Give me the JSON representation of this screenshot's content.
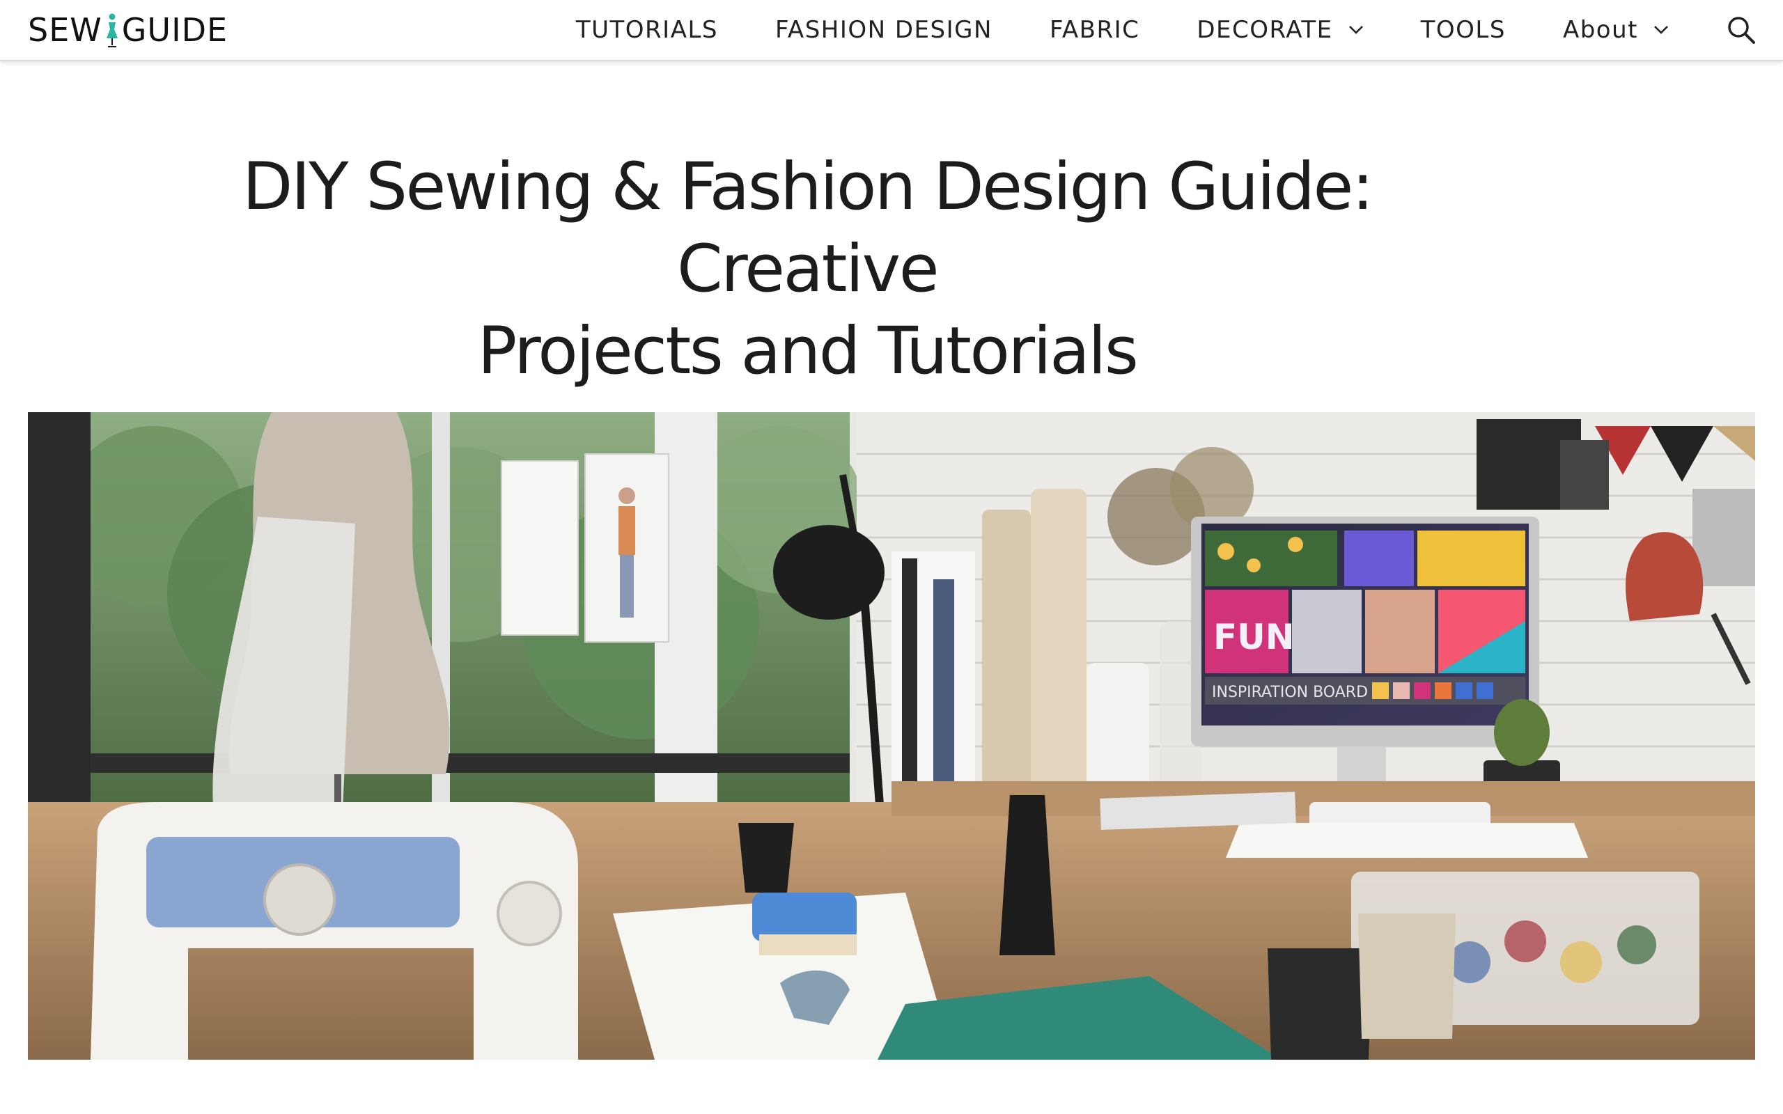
{
  "header": {
    "logo": {
      "text_left": "SEW",
      "text_right": "GUIDE",
      "icon": "dress-form-icon"
    },
    "nav": [
      {
        "label": "TUTORIALS",
        "has_dropdown": false
      },
      {
        "label": "FASHION DESIGN",
        "has_dropdown": false
      },
      {
        "label": "FABRIC",
        "has_dropdown": false
      },
      {
        "label": "DECORATE",
        "has_dropdown": true
      },
      {
        "label": "TOOLS",
        "has_dropdown": false
      },
      {
        "label": "About",
        "has_dropdown": true
      }
    ],
    "search_icon": "search-icon"
  },
  "page": {
    "title_line1": "DIY Sewing & Fashion Design Guide: Creative",
    "title_line2": "Projects and Tutorials"
  },
  "hero": {
    "monitor_text": "INSPIRATION BOARD",
    "moodboard_word": "FUN"
  },
  "colors": {
    "logo_accent": "#2bb3a3",
    "text": "#222222",
    "header_border": "#d9d9d9"
  }
}
